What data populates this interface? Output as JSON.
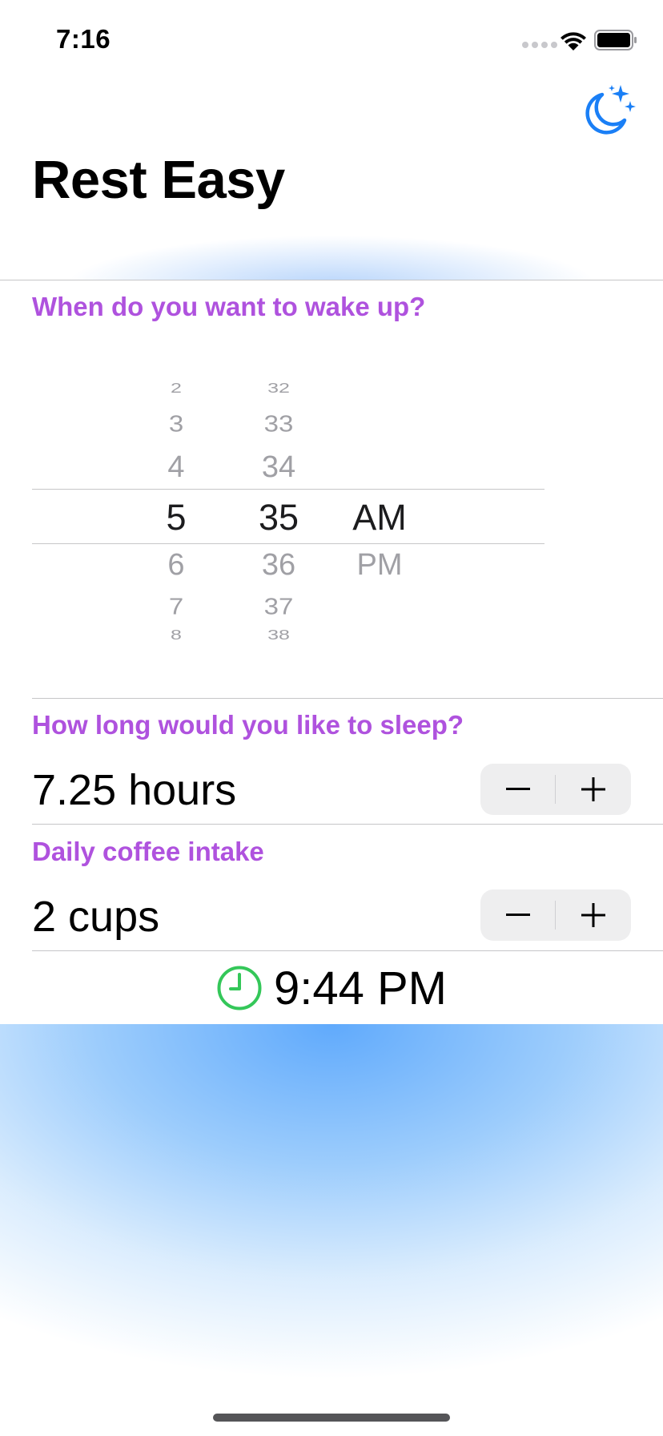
{
  "status_bar": {
    "time": "7:16"
  },
  "header": {
    "title": "Rest Easy",
    "moon_icon": "moon-stars-icon",
    "accent_color": "#1a7ff6"
  },
  "wake_section": {
    "label": "When do you want to wake up?",
    "picker": {
      "hours": [
        "2",
        "3",
        "4",
        "5",
        "6",
        "7",
        "8"
      ],
      "minutes": [
        "32",
        "33",
        "34",
        "35",
        "36",
        "37",
        "38"
      ],
      "periods": [
        "AM",
        "PM"
      ],
      "selected": {
        "hour": "5",
        "minute": "35",
        "period": "AM"
      }
    }
  },
  "sleep_section": {
    "label": "How long would you like to sleep?",
    "value": "7.25 hours",
    "minus_label": "−",
    "plus_label": "+"
  },
  "coffee_section": {
    "label": "Daily coffee intake",
    "value": "2 cups",
    "minus_label": "−",
    "plus_label": "+"
  },
  "result": {
    "icon": "clock-icon",
    "icon_color": "#34c759",
    "bedtime": "9:44 PM"
  },
  "colors": {
    "section_label": "#af52de",
    "background_glow": "#60aafc"
  }
}
